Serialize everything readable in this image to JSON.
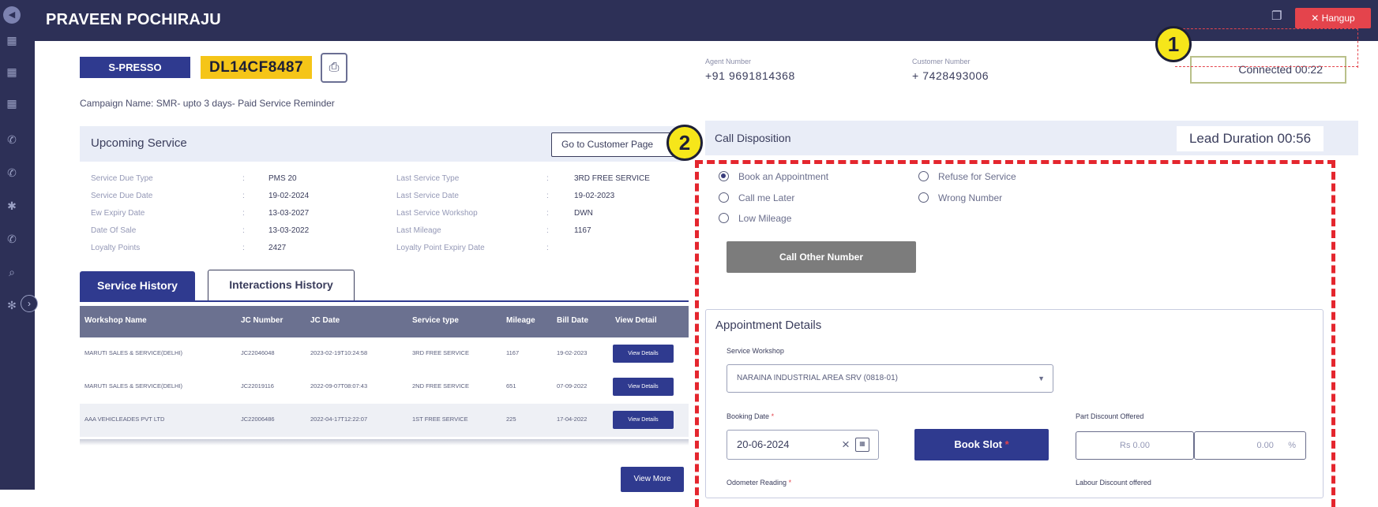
{
  "header": {
    "agent_name": "PRAVEEN POCHIRAJU",
    "hangup_label": "✕ Hangup"
  },
  "vehicle": {
    "model": "S-PRESSO",
    "registration": "DL14CF8487",
    "campaign": "Campaign Name: SMR- upto 3 days- Paid Service Reminder"
  },
  "call": {
    "agent_number_label": "Agent Number",
    "agent_number": "+91 9691814368",
    "customer_number_label": "Customer Number",
    "customer_number": "+ 7428493006",
    "connected": "Connected 00:22"
  },
  "callouts": [
    "1",
    "2"
  ],
  "upcoming": {
    "title": "Upcoming Service",
    "go_button": "Go to Customer Page",
    "left": [
      {
        "label": "Service Due Type",
        "value": "PMS 20"
      },
      {
        "label": "Service Due Date",
        "value": "19-02-2024"
      },
      {
        "label": "Ew Expiry Date",
        "value": "13-03-2027"
      },
      {
        "label": "Date Of Sale",
        "value": "13-03-2022"
      },
      {
        "label": "Loyalty Points",
        "value": "2427"
      }
    ],
    "right": [
      {
        "label": "Last Service Type",
        "value": "3RD FREE SERVICE"
      },
      {
        "label": "Last Service Date",
        "value": "19-02-2023"
      },
      {
        "label": "Last Service Workshop",
        "value": "DWN"
      },
      {
        "label": "Last Mileage",
        "value": "1167"
      },
      {
        "label": "Loyalty Point Expiry Date",
        "value": ""
      }
    ]
  },
  "tabs": {
    "service_history": "Service History",
    "interactions_history": "Interactions History"
  },
  "table": {
    "headers": [
      "Workshop Name",
      "JC Number",
      "JC Date",
      "Service type",
      "Mileage",
      "Bill Date",
      "View Detail"
    ],
    "rows": [
      [
        "MARUTI SALES & SERVICE(DELHI)",
        "JC22046048",
        "2023-02-19T10:24:58",
        "3RD FREE SERVICE",
        "1167",
        "19-02-2023",
        "View Details"
      ],
      [
        "MARUTI SALES & SERVICE(DELHI)",
        "JC22019116",
        "2022-09-07T08:07:43",
        "2ND FREE SERVICE",
        "651",
        "07-09-2022",
        "View Details"
      ],
      [
        "AAA VEHICLEADES PVT LTD",
        "JC22006486",
        "2022-04-17T12:22:07",
        "1ST FREE SERVICE",
        "225",
        "17-04-2022",
        "View Details"
      ]
    ],
    "view_more": "View More"
  },
  "disposition": {
    "title": "Call Disposition",
    "lead_duration": "Lead Duration 00:56",
    "options": [
      {
        "label": "Book an Appointment",
        "selected": true
      },
      {
        "label": "Call me Later",
        "selected": false
      },
      {
        "label": "Low Mileage",
        "selected": false
      },
      {
        "label": "Refuse for Service",
        "selected": false
      },
      {
        "label": "Wrong Number",
        "selected": false
      }
    ],
    "call_other": "Call Other Number"
  },
  "appointment": {
    "title": "Appointment Details",
    "workshop_label": "Service Workshop",
    "workshop_value": "NARAINA INDUSTRIAL AREA SRV (0818-01)",
    "booking_label": "Booking Date",
    "booking_value": "20-06-2024",
    "book_slot": "Book Slot",
    "part_discount_label": "Part Discount Offered",
    "part_discount_rs": "Rs 0.00",
    "part_discount_pct": "0.00",
    "pct_symbol": "%",
    "odometer_label": "Odometer Reading",
    "labour_discount_label": "Labour Discount offered"
  },
  "colors": {
    "navy": "#2d3057",
    "primary": "#2f3a8f",
    "plate_yellow": "#f5c518",
    "hangup_red": "#e4444c",
    "callout_yellow": "#f6e61a"
  }
}
